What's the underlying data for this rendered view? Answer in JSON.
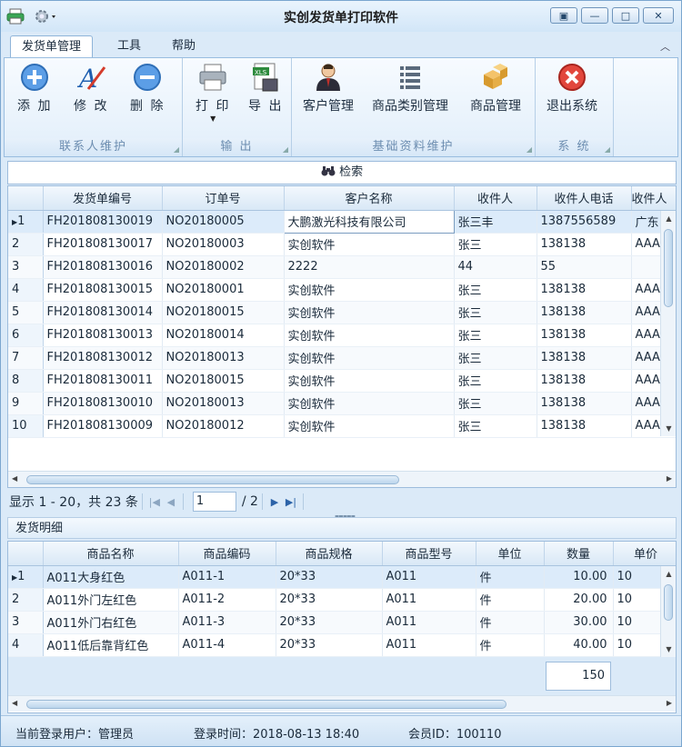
{
  "window": {
    "title": "实创发货单打印软件"
  },
  "menu_tabs": [
    "发货单管理",
    "工具",
    "帮助"
  ],
  "ribbon": {
    "groups": [
      {
        "label": "联系人维护",
        "buttons": [
          "添 加",
          "修 改",
          "删 除"
        ]
      },
      {
        "label": "输 出",
        "buttons": [
          "打 印",
          "导 出"
        ]
      },
      {
        "label": "基础资料维护",
        "buttons": [
          "客户管理",
          "商品类别管理",
          "商品管理"
        ]
      },
      {
        "label": "系 统",
        "buttons": [
          "退出系统"
        ]
      }
    ],
    "export_icon_text": "XLS"
  },
  "search": {
    "label": "检索"
  },
  "orders": {
    "columns": [
      "发货单编号",
      "订单号",
      "客户名称",
      "收件人",
      "收件人电话",
      "收件人"
    ],
    "rows": [
      [
        "1",
        "FH201808130019",
        "NO20180005",
        "大鹏激光科技有限公司",
        "张三丰",
        "1387556589",
        "广东"
      ],
      [
        "2",
        "FH201808130017",
        "NO20180003",
        "实创软件",
        "张三",
        "138138",
        "AAA"
      ],
      [
        "3",
        "FH201808130016",
        "NO20180002",
        "2222",
        "44",
        "55",
        ""
      ],
      [
        "4",
        "FH201808130015",
        "NO20180001",
        "实创软件",
        "张三",
        "138138",
        "AAA"
      ],
      [
        "5",
        "FH201808130014",
        "NO20180015",
        "实创软件",
        "张三",
        "138138",
        "AAA"
      ],
      [
        "6",
        "FH201808130013",
        "NO20180014",
        "实创软件",
        "张三",
        "138138",
        "AAA"
      ],
      [
        "7",
        "FH201808130012",
        "NO20180013",
        "实创软件",
        "张三",
        "138138",
        "AAA"
      ],
      [
        "8",
        "FH201808130011",
        "NO20180015",
        "实创软件",
        "张三",
        "138138",
        "AAA"
      ],
      [
        "9",
        "FH201808130010",
        "NO20180013",
        "实创软件",
        "张三",
        "138138",
        "AAA"
      ],
      [
        "10",
        "FH201808130009",
        "NO20180012",
        "实创软件",
        "张三",
        "138138",
        "AAA"
      ]
    ]
  },
  "pager": {
    "summary": "显示 1 - 20，共 23 条",
    "page": "1",
    "total_pages": "/ 2"
  },
  "detail": {
    "title": "发货明细",
    "columns": [
      "商品名称",
      "商品编码",
      "商品规格",
      "商品型号",
      "单位",
      "数量",
      "单价"
    ],
    "rows": [
      [
        "1",
        "A011大身红色",
        "A011-1",
        "20*33",
        "A011",
        "件",
        "10.00",
        "10"
      ],
      [
        "2",
        "A011外门左红色",
        "A011-2",
        "20*33",
        "A011",
        "件",
        "20.00",
        "10"
      ],
      [
        "3",
        "A011外门右红色",
        "A011-3",
        "20*33",
        "A011",
        "件",
        "30.00",
        "10"
      ],
      [
        "4",
        "A011低后靠背红色",
        "A011-4",
        "20*33",
        "A011",
        "件",
        "40.00",
        "10"
      ]
    ],
    "total_quantity": "150"
  },
  "status": {
    "user": "当前登录用户：管理员",
    "login_time": "登录时间：2018-08-13 18:40",
    "member_id": "会员ID：100110"
  }
}
